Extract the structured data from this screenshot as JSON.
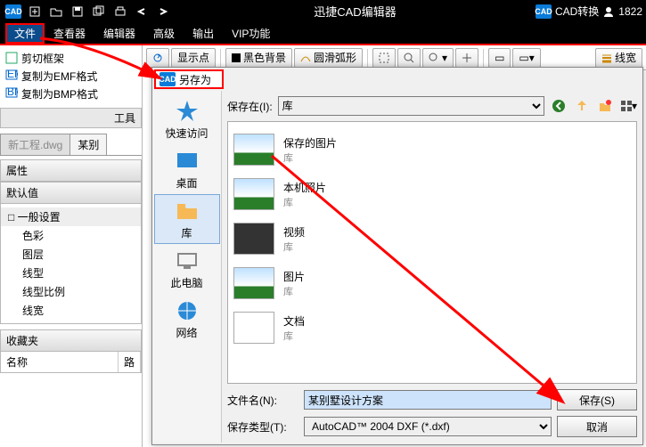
{
  "titlebar": {
    "app": "迅捷CAD编辑器",
    "convert": "CAD转换",
    "user": "1822"
  },
  "menus": {
    "file": "文件",
    "viewer": "查看器",
    "editor": "编辑器",
    "advanced": "高级",
    "output": "输出",
    "vip": "VIP功能"
  },
  "tools": {
    "clip": "剪切框架",
    "emf": "复制为EMF格式",
    "bmp": "复制为BMP格式",
    "caption": "工具"
  },
  "tabs": {
    "t1": "新工程.dwg",
    "t2": "某别"
  },
  "props": {
    "head": "属性",
    "default": "默认值",
    "general": "一般设置",
    "color": "色彩",
    "layer": "图层",
    "ltype": "线型",
    "lscale": "线型比例",
    "lweight": "线宽"
  },
  "fav": {
    "head": "收藏夹",
    "col1": "名称",
    "col2": "路"
  },
  "tb2": {
    "showpt": "显示点",
    "blackbg": "黑色背景",
    "smooth": "圆滑弧形",
    "lw": "线宽"
  },
  "dialog": {
    "title": "另存为",
    "savein": "保存在(I):",
    "loc": "库",
    "places": {
      "quick": "快速访问",
      "desktop": "桌面",
      "lib": "库",
      "pc": "此电脑",
      "net": "网络"
    },
    "items": [
      {
        "t": "保存的图片",
        "s": "库",
        "k": "img"
      },
      {
        "t": "本机照片",
        "s": "库",
        "k": "img"
      },
      {
        "t": "视频",
        "s": "库",
        "k": "vid"
      },
      {
        "t": "图片",
        "s": "库",
        "k": "img"
      },
      {
        "t": "文档",
        "s": "库",
        "k": "doc"
      }
    ],
    "fname_l": "文件名(N):",
    "fname_v": "某别墅设计方案",
    "ftype_l": "保存类型(T):",
    "ftype_v": "AutoCAD™ 2004 DXF (*.dxf)",
    "save": "保存(S)",
    "cancel": "取消"
  }
}
